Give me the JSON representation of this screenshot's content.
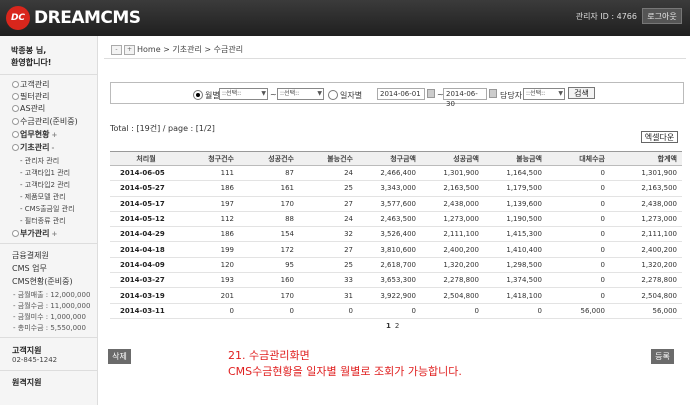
{
  "header": {
    "logo_mark": "DC",
    "logo_text": "DREAMCMS",
    "admin_id": "관리자 ID : 4766",
    "logout_label": "로그아웃"
  },
  "sidebar": {
    "greeting_line1": "박종봉 님,",
    "greeting_line2": "환영합니다!",
    "menu": [
      {
        "label": "고객관리"
      },
      {
        "label": "필터관리"
      },
      {
        "label": "AS관리"
      },
      {
        "label": "수금관리(준비중)"
      },
      {
        "label": "업무현황"
      },
      {
        "label": "기초관리"
      }
    ],
    "submenu": [
      "- 관리자 관리",
      "- 고객타입1 관리",
      "- 고객타입2 관리",
      "- 제품모델 관리",
      "- CMS출금일 관리",
      "- 필터종류 관리"
    ],
    "extra_menu": "부가관리",
    "finance": {
      "title": "금융결제원",
      "cms_work": "CMS 업무",
      "cms_status": "CMS현황(준비중)",
      "items": [
        "- 금월매출 : 12,000,000",
        "- 금월수금 : 11,000,000",
        "- 금월미수 : 1,000,000",
        "- 총미수금 : 5,550,000"
      ]
    },
    "customer_support_title": "고객지원",
    "customer_support_phone": "02-845-1242",
    "remote_support_title": "원격지원"
  },
  "breadcrumb": {
    "home": "Home",
    "sep": ">",
    "level1": "기초관리",
    "level2": "수금관리"
  },
  "search": {
    "monthly_label": "월별",
    "daily_label": "일자별",
    "select_placeholder": "::선택::",
    "tilde": "~",
    "date_from": "2014-06-01",
    "date_to": "2014-06-30",
    "manager_label": "담당자",
    "search_label": "검색"
  },
  "total_text": "Total : [19건] / page : [1/2]",
  "excel_label": "엑셀다운",
  "table": {
    "headers": [
      "처리월",
      "청구건수",
      "성공건수",
      "불능건수",
      "청구금액",
      "성공금액",
      "불능금액",
      "대체수금",
      "합계액"
    ],
    "rows": [
      [
        "2014-06-05",
        "111",
        "87",
        "24",
        "2,466,400",
        "1,301,900",
        "1,164,500",
        "0",
        "1,301,900"
      ],
      [
        "2014-05-27",
        "186",
        "161",
        "25",
        "3,343,000",
        "2,163,500",
        "1,179,500",
        "0",
        "2,163,500"
      ],
      [
        "2014-05-17",
        "197",
        "170",
        "27",
        "3,577,600",
        "2,438,000",
        "1,139,600",
        "0",
        "2,438,000"
      ],
      [
        "2014-05-12",
        "112",
        "88",
        "24",
        "2,463,500",
        "1,273,000",
        "1,190,500",
        "0",
        "1,273,000"
      ],
      [
        "2014-04-29",
        "186",
        "154",
        "32",
        "3,526,400",
        "2,111,100",
        "1,415,300",
        "0",
        "2,111,100"
      ],
      [
        "2014-04-18",
        "199",
        "172",
        "27",
        "3,810,600",
        "2,400,200",
        "1,410,400",
        "0",
        "2,400,200"
      ],
      [
        "2014-04-09",
        "120",
        "95",
        "25",
        "2,618,700",
        "1,320,200",
        "1,298,500",
        "0",
        "1,320,200"
      ],
      [
        "2014-03-27",
        "193",
        "160",
        "33",
        "3,653,300",
        "2,278,800",
        "1,374,500",
        "0",
        "2,278,800"
      ],
      [
        "2014-03-19",
        "201",
        "170",
        "31",
        "3,922,900",
        "2,504,800",
        "1,418,100",
        "0",
        "2,504,800"
      ],
      [
        "2014-03-11",
        "0",
        "0",
        "0",
        "0",
        "0",
        "0",
        "56,000",
        "56,000"
      ]
    ]
  },
  "pager": {
    "current": "1",
    "next": "2"
  },
  "delete_label": "삭제",
  "register_label": "등록",
  "caption_line1": "21. 수금관리화면",
  "caption_line2": "CMS수금현황을 일자별 월별로 조회가 가능합니다."
}
